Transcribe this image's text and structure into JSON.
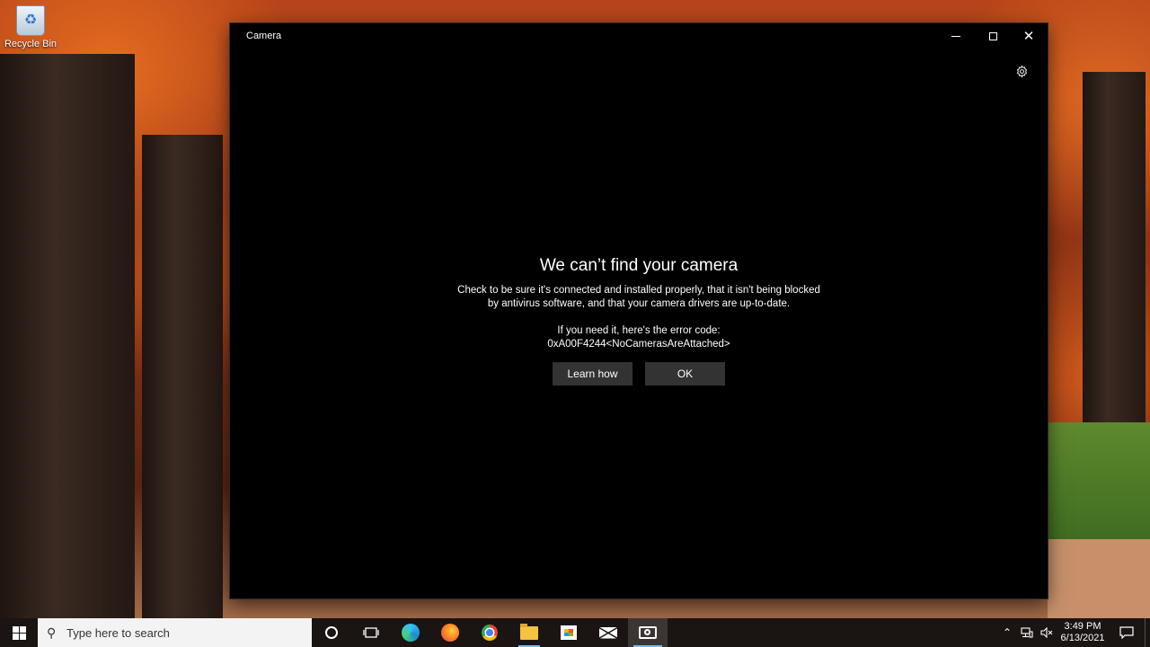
{
  "desktop": {
    "recycle_bin_label": "Recycle Bin"
  },
  "window": {
    "title": "Camera",
    "minimize_icon": "minimize-icon",
    "maximize_icon": "maximize-icon",
    "close_icon": "close-icon",
    "settings_icon": "gear-icon"
  },
  "error": {
    "heading": "We can’t find your camera",
    "description_line1": "Check to be sure it's connected and installed properly, that it isn't being blocked",
    "description_line2": "by antivirus software, and that your camera drivers are up-to-date.",
    "code_label": "If you need it, here's the error code:",
    "code_value": "0xA00F4244<NoCamerasAreAttached>",
    "learn_how_label": "Learn how",
    "ok_label": "OK"
  },
  "taskbar": {
    "search_placeholder": "Type here to search",
    "apps": [
      {
        "name": "cortana-icon"
      },
      {
        "name": "task-view-icon"
      },
      {
        "name": "edge-icon"
      },
      {
        "name": "firefox-icon"
      },
      {
        "name": "chrome-icon"
      },
      {
        "name": "file-explorer-icon"
      },
      {
        "name": "microsoft-store-icon"
      },
      {
        "name": "mail-icon"
      },
      {
        "name": "camera-app-icon"
      }
    ],
    "time": "3:49 PM",
    "date": "6/13/2021"
  },
  "colors": {
    "taskbar_bg": "#1a1413",
    "button_bg": "#333333",
    "accent": "#76b9ed"
  }
}
